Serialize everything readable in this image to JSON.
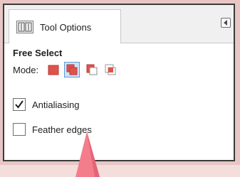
{
  "tab": {
    "label": "Tool Options",
    "icon": "tool-options-icon"
  },
  "tab_menu": {
    "icon": "tab-menu-icon"
  },
  "tool": {
    "title": "Free Select"
  },
  "mode": {
    "label": "Mode:",
    "options": [
      {
        "name": "replace",
        "icon": "mode-replace-icon",
        "selected": false
      },
      {
        "name": "add",
        "icon": "mode-add-icon",
        "selected": true
      },
      {
        "name": "subtract",
        "icon": "mode-subtract-icon",
        "selected": false
      },
      {
        "name": "intersect",
        "icon": "mode-intersect-icon",
        "selected": false
      }
    ]
  },
  "options": {
    "antialiasing": {
      "label": "Antialiasing",
      "checked": true
    },
    "feather": {
      "label": "Feather edges",
      "checked": false
    }
  },
  "colors": {
    "accent_red": "#e0534d",
    "selection_blue": "#5b9bd5",
    "annotation_pink": "#f47d8c"
  }
}
